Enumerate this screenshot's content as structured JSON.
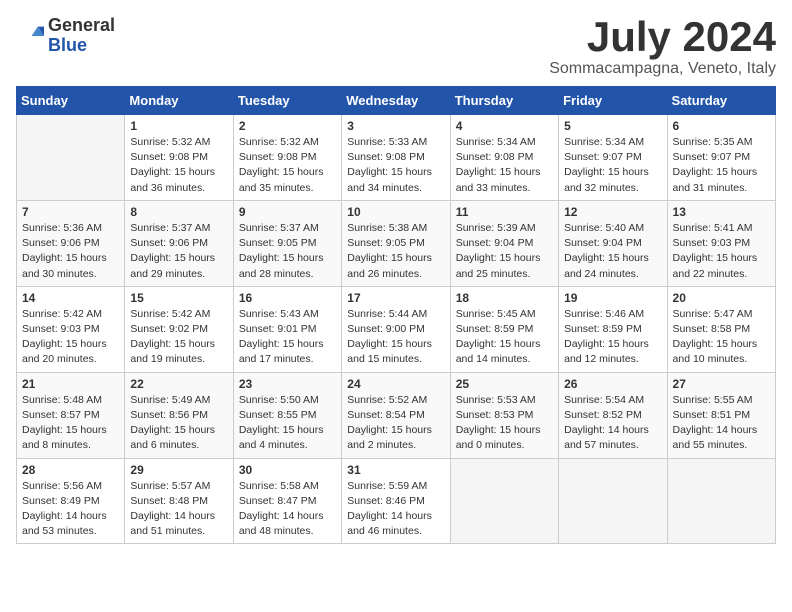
{
  "header": {
    "logo_general": "General",
    "logo_blue": "Blue",
    "month": "July 2024",
    "location": "Sommacampagna, Veneto, Italy"
  },
  "days_of_week": [
    "Sunday",
    "Monday",
    "Tuesday",
    "Wednesday",
    "Thursday",
    "Friday",
    "Saturday"
  ],
  "weeks": [
    [
      {
        "day": "",
        "empty": true
      },
      {
        "day": "1",
        "sunrise": "Sunrise: 5:32 AM",
        "sunset": "Sunset: 9:08 PM",
        "daylight": "Daylight: 15 hours and 36 minutes."
      },
      {
        "day": "2",
        "sunrise": "Sunrise: 5:32 AM",
        "sunset": "Sunset: 9:08 PM",
        "daylight": "Daylight: 15 hours and 35 minutes."
      },
      {
        "day": "3",
        "sunrise": "Sunrise: 5:33 AM",
        "sunset": "Sunset: 9:08 PM",
        "daylight": "Daylight: 15 hours and 34 minutes."
      },
      {
        "day": "4",
        "sunrise": "Sunrise: 5:34 AM",
        "sunset": "Sunset: 9:08 PM",
        "daylight": "Daylight: 15 hours and 33 minutes."
      },
      {
        "day": "5",
        "sunrise": "Sunrise: 5:34 AM",
        "sunset": "Sunset: 9:07 PM",
        "daylight": "Daylight: 15 hours and 32 minutes."
      },
      {
        "day": "6",
        "sunrise": "Sunrise: 5:35 AM",
        "sunset": "Sunset: 9:07 PM",
        "daylight": "Daylight: 15 hours and 31 minutes."
      }
    ],
    [
      {
        "day": "7",
        "sunrise": "Sunrise: 5:36 AM",
        "sunset": "Sunset: 9:06 PM",
        "daylight": "Daylight: 15 hours and 30 minutes."
      },
      {
        "day": "8",
        "sunrise": "Sunrise: 5:37 AM",
        "sunset": "Sunset: 9:06 PM",
        "daylight": "Daylight: 15 hours and 29 minutes."
      },
      {
        "day": "9",
        "sunrise": "Sunrise: 5:37 AM",
        "sunset": "Sunset: 9:05 PM",
        "daylight": "Daylight: 15 hours and 28 minutes."
      },
      {
        "day": "10",
        "sunrise": "Sunrise: 5:38 AM",
        "sunset": "Sunset: 9:05 PM",
        "daylight": "Daylight: 15 hours and 26 minutes."
      },
      {
        "day": "11",
        "sunrise": "Sunrise: 5:39 AM",
        "sunset": "Sunset: 9:04 PM",
        "daylight": "Daylight: 15 hours and 25 minutes."
      },
      {
        "day": "12",
        "sunrise": "Sunrise: 5:40 AM",
        "sunset": "Sunset: 9:04 PM",
        "daylight": "Daylight: 15 hours and 24 minutes."
      },
      {
        "day": "13",
        "sunrise": "Sunrise: 5:41 AM",
        "sunset": "Sunset: 9:03 PM",
        "daylight": "Daylight: 15 hours and 22 minutes."
      }
    ],
    [
      {
        "day": "14",
        "sunrise": "Sunrise: 5:42 AM",
        "sunset": "Sunset: 9:03 PM",
        "daylight": "Daylight: 15 hours and 20 minutes."
      },
      {
        "day": "15",
        "sunrise": "Sunrise: 5:42 AM",
        "sunset": "Sunset: 9:02 PM",
        "daylight": "Daylight: 15 hours and 19 minutes."
      },
      {
        "day": "16",
        "sunrise": "Sunrise: 5:43 AM",
        "sunset": "Sunset: 9:01 PM",
        "daylight": "Daylight: 15 hours and 17 minutes."
      },
      {
        "day": "17",
        "sunrise": "Sunrise: 5:44 AM",
        "sunset": "Sunset: 9:00 PM",
        "daylight": "Daylight: 15 hours and 15 minutes."
      },
      {
        "day": "18",
        "sunrise": "Sunrise: 5:45 AM",
        "sunset": "Sunset: 8:59 PM",
        "daylight": "Daylight: 15 hours and 14 minutes."
      },
      {
        "day": "19",
        "sunrise": "Sunrise: 5:46 AM",
        "sunset": "Sunset: 8:59 PM",
        "daylight": "Daylight: 15 hours and 12 minutes."
      },
      {
        "day": "20",
        "sunrise": "Sunrise: 5:47 AM",
        "sunset": "Sunset: 8:58 PM",
        "daylight": "Daylight: 15 hours and 10 minutes."
      }
    ],
    [
      {
        "day": "21",
        "sunrise": "Sunrise: 5:48 AM",
        "sunset": "Sunset: 8:57 PM",
        "daylight": "Daylight: 15 hours and 8 minutes."
      },
      {
        "day": "22",
        "sunrise": "Sunrise: 5:49 AM",
        "sunset": "Sunset: 8:56 PM",
        "daylight": "Daylight: 15 hours and 6 minutes."
      },
      {
        "day": "23",
        "sunrise": "Sunrise: 5:50 AM",
        "sunset": "Sunset: 8:55 PM",
        "daylight": "Daylight: 15 hours and 4 minutes."
      },
      {
        "day": "24",
        "sunrise": "Sunrise: 5:52 AM",
        "sunset": "Sunset: 8:54 PM",
        "daylight": "Daylight: 15 hours and 2 minutes."
      },
      {
        "day": "25",
        "sunrise": "Sunrise: 5:53 AM",
        "sunset": "Sunset: 8:53 PM",
        "daylight": "Daylight: 15 hours and 0 minutes."
      },
      {
        "day": "26",
        "sunrise": "Sunrise: 5:54 AM",
        "sunset": "Sunset: 8:52 PM",
        "daylight": "Daylight: 14 hours and 57 minutes."
      },
      {
        "day": "27",
        "sunrise": "Sunrise: 5:55 AM",
        "sunset": "Sunset: 8:51 PM",
        "daylight": "Daylight: 14 hours and 55 minutes."
      }
    ],
    [
      {
        "day": "28",
        "sunrise": "Sunrise: 5:56 AM",
        "sunset": "Sunset: 8:49 PM",
        "daylight": "Daylight: 14 hours and 53 minutes."
      },
      {
        "day": "29",
        "sunrise": "Sunrise: 5:57 AM",
        "sunset": "Sunset: 8:48 PM",
        "daylight": "Daylight: 14 hours and 51 minutes."
      },
      {
        "day": "30",
        "sunrise": "Sunrise: 5:58 AM",
        "sunset": "Sunset: 8:47 PM",
        "daylight": "Daylight: 14 hours and 48 minutes."
      },
      {
        "day": "31",
        "sunrise": "Sunrise: 5:59 AM",
        "sunset": "Sunset: 8:46 PM",
        "daylight": "Daylight: 14 hours and 46 minutes."
      },
      {
        "day": "",
        "empty": true
      },
      {
        "day": "",
        "empty": true
      },
      {
        "day": "",
        "empty": true
      }
    ]
  ]
}
